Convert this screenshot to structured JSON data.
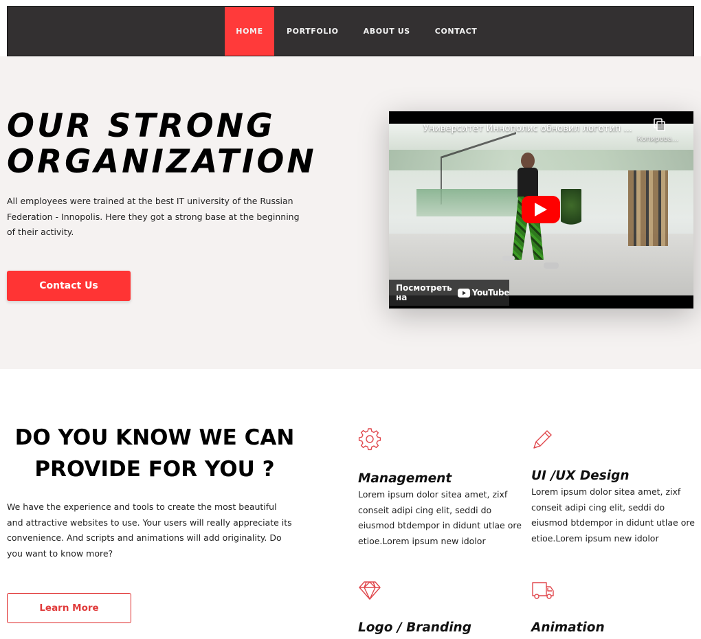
{
  "nav": {
    "items": [
      {
        "label": "HOME",
        "active": true
      },
      {
        "label": "PORTFOLIO",
        "active": false
      },
      {
        "label": "ABOUT US",
        "active": false
      },
      {
        "label": "CONTACT",
        "active": false
      }
    ]
  },
  "hero": {
    "title": "OUR STRONG\nORGANIZATION",
    "text": "All employees were trained at the best IT university of the Russian Federation - Innopolis. Here they got a strong base at the beginning of their activity.",
    "contact_button": "Contact Us"
  },
  "video": {
    "title": "Университет Иннополис обновил логотип ...",
    "copy_label": "Копирова...",
    "watch_label": "Посмотреть на",
    "youtube_label": "YouTube"
  },
  "services": {
    "title": "DO YOU KNOW WE CAN\nPROVIDE FOR YOU ?",
    "text": "We have the experience and tools to create the most beautiful and attractive websites to use. Your users will really appreciate its convenience. And scripts and animations will add originality. Do you want to know more?",
    "learn_button": "Learn More",
    "items": [
      {
        "icon": "gear-icon",
        "title": "Management",
        "text": "Lorem ipsum dolor sitea amet, zixf conseit adipi cing elit, seddi do eiusmod btdempor in didunt utlae ore etioe.Lorem ipsum new idolor"
      },
      {
        "icon": "pencil-icon",
        "title": "UI /UX Design",
        "text": "Lorem ipsum dolor sitea amet, zixf conseit adipi cing elit, seddi do eiusmod btdempor in didunt utlae ore etioe.Lorem ipsum new idolor"
      },
      {
        "icon": "diamond-icon",
        "title": "Logo / Branding",
        "text": ""
      },
      {
        "icon": "truck-icon",
        "title": "Animation",
        "text": ""
      }
    ]
  },
  "colors": {
    "accent": "#ff3434",
    "nav_bg": "#333031",
    "hero_bg": "#f5f2f1"
  }
}
